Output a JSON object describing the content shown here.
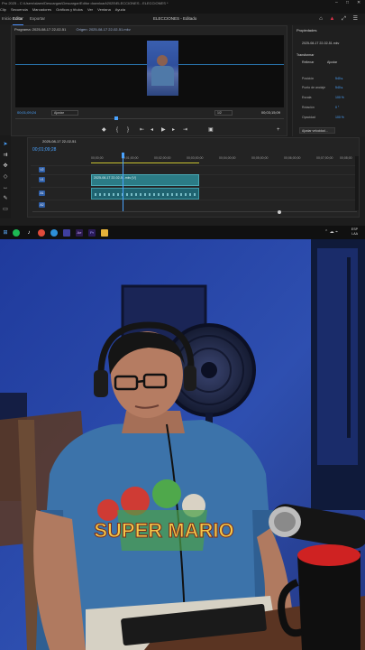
{
  "window": {
    "title": "Pro 2025 - C:\\Users\\slaen\\Descargas\\Descargar\\Editor download\\2025\\ELECCIONES - ELECCIONES *",
    "controls": [
      "–",
      "□",
      "✕"
    ]
  },
  "menu": {
    "items": [
      "Clip",
      "Secuencia",
      "Marcadores",
      "Gráficos y títulos",
      "Ver",
      "Ventana",
      "Ayuda"
    ]
  },
  "workspaces": {
    "tabs": [
      "Inicio",
      "Editar",
      "Exportar"
    ],
    "center_title": "ELECCIONES - Editado",
    "icons": [
      "home-icon",
      "bell-icon",
      "expand-icon",
      "share-icon"
    ]
  },
  "program_monitor": {
    "tab_program": "Programa: 2025-08-17 22-02-51",
    "tab_source": "Origen: 2025-08-17 22-02-51.mkv",
    "timecode_current": "00;01;09;24",
    "fit_label": "Ajustar",
    "resolution_label": "1/2",
    "timecode_total": "00;03;15;09",
    "playhead_fraction": 0.37
  },
  "properties": {
    "title": "Propiedades",
    "file": "2025-08-17 22-02-51.mkv",
    "section": "Transformar",
    "checkbox_1": "Rellenar",
    "checkbox_2": "Ajustar",
    "rows": [
      {
        "label": "Posición",
        "value": "540 ▸"
      },
      {
        "label": "Punto de anclaje",
        "value": "540 ▸"
      },
      {
        "label": "Escala",
        "value": "100 %"
      },
      {
        "label": "Rotación",
        "value": "0 °"
      },
      {
        "label": "Opacidad",
        "value": "100 %"
      }
    ],
    "button": "Ajustar velocidad..."
  },
  "tools": [
    "selection-tool",
    "track-select-tool",
    "ripple-edit-tool",
    "razor-tool",
    "slip-tool",
    "pen-tool",
    "rectangle-tool",
    "hand-tool",
    "type-tool"
  ],
  "timeline": {
    "sequence_tab": "2025-08-17 22-02-51",
    "timecode": "00;01;09;28",
    "ruler": [
      "00;00;00",
      "00;01;00;00",
      "00;02;00;00",
      "00;03;00;00",
      "00;04;00;00",
      "00;05;00;00",
      "00;06;00;00",
      "00;07;00;00",
      "00;08;00"
    ],
    "tracks": [
      {
        "id": "V2",
        "kind": "video"
      },
      {
        "id": "V1",
        "kind": "video"
      },
      {
        "id": "A1",
        "kind": "audio"
      },
      {
        "id": "A2",
        "kind": "audio"
      }
    ],
    "video_clip_label": "2025-08-17 22-02-51.mkv [V]",
    "playhead_fraction": 0.12
  },
  "taskbar": {
    "apps": [
      "start-icon",
      "search-icon",
      "spotify-icon",
      "tiktok-icon",
      "chrome-icon",
      "edge-icon",
      "phone-link-icon",
      "ae-icon",
      "pr-icon",
      "explorer-icon"
    ],
    "lang": "ESP",
    "lang_sub": "LAA"
  },
  "colors": {
    "accent": "#4aa3ff",
    "clip_video": "#2b7c86",
    "clip_audio": "#1f6370",
    "panel_bg": "#232323",
    "webcam_wall": "#2a3f8f"
  },
  "webcam": {
    "shirt_print": "SUPER MARIO"
  }
}
